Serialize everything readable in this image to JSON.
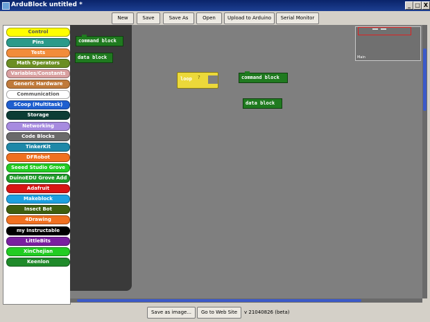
{
  "window": {
    "title": "ArduBlock untitled *",
    "controls": [
      "_",
      "□",
      "X"
    ]
  },
  "toolbar": {
    "buttons": [
      "New",
      "Save",
      "Save As",
      "Open",
      "Upload to Arduino",
      "Serial Monitor"
    ]
  },
  "palette": {
    "categories": [
      {
        "label": "Control",
        "color": "#ffff00"
      },
      {
        "label": "Pins",
        "color": "#2b9a8a"
      },
      {
        "label": "Tests",
        "color": "#f28c3a"
      },
      {
        "label": "Math Operators",
        "color": "#6b8e23"
      },
      {
        "label": "Variables/Constants",
        "color": "#d9a0a0"
      },
      {
        "label": "Generic Hardware",
        "color": "#c07a3a"
      },
      {
        "label": "Communication",
        "color": "#ffffff"
      },
      {
        "label": "SCoop (Multitask)",
        "color": "#1f5fd0"
      },
      {
        "label": "Storage",
        "color": "#0d3d35"
      },
      {
        "label": "Networking",
        "color": "#a78be0"
      },
      {
        "label": "Code Blocks",
        "color": "#6a6a6a"
      },
      {
        "label": "TinkerKit",
        "color": "#1e88a8"
      },
      {
        "label": "DFRobot",
        "color": "#f07020"
      },
      {
        "label": "Seeed Studio Grove",
        "color": "#22cc22"
      },
      {
        "label": "DuinoEDU Grove Add",
        "color": "#1f9a2a"
      },
      {
        "label": "Adafruit",
        "color": "#d81414"
      },
      {
        "label": "Makeblock",
        "color": "#1ea0e0"
      },
      {
        "label": "Insect Bot",
        "color": "#3f5f0f"
      },
      {
        "label": "4Drawing",
        "color": "#f07020"
      },
      {
        "label": "my Instructable",
        "color": "#000000"
      },
      {
        "label": "LittleBits",
        "color": "#7a1fa0"
      },
      {
        "label": "XinChejian",
        "color": "#22cc22"
      },
      {
        "label": "Keenlon",
        "color": "#1f8a2a"
      }
    ]
  },
  "drawer": {
    "blocks": [
      "command block",
      "data block"
    ]
  },
  "canvas": {
    "loop_label": "loop",
    "loop_hint": "?",
    "command_block": "command block",
    "data_block": "data block"
  },
  "minimap": {
    "caption": "Main"
  },
  "bottom": {
    "buttons": [
      "Save as image...",
      "Go to Web Site"
    ],
    "version": "v 21040826 (beta)"
  }
}
